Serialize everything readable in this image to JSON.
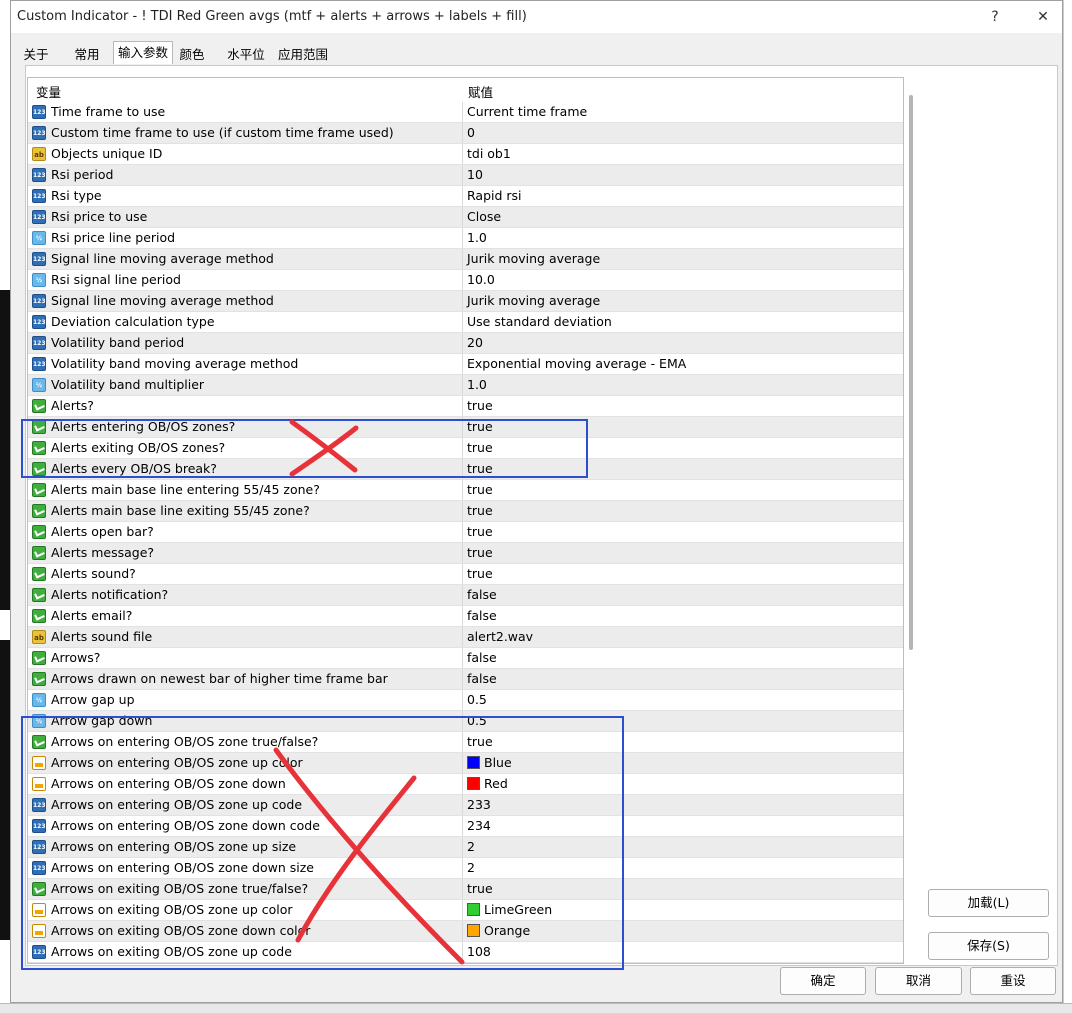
{
  "window": {
    "title": "Custom Indicator - ! TDI Red Green avgs  (mtf + alerts + arrows + labels + fill)",
    "help_glyph": "?",
    "close_glyph": "✕"
  },
  "tabs": [
    {
      "label": "关于"
    },
    {
      "label": "常用"
    },
    {
      "label": "输入参数"
    },
    {
      "label": "颜色"
    },
    {
      "label": "水平位"
    },
    {
      "label": "应用范围"
    }
  ],
  "table": {
    "col_variable": "变量",
    "col_value": "赋值",
    "rows": [
      {
        "type": "int",
        "name": "Time frame to use",
        "value": "Current time frame"
      },
      {
        "type": "int",
        "name": "Custom time frame to use (if custom time frame used)",
        "value": "0"
      },
      {
        "type": "str",
        "name": "Objects unique ID",
        "value": "tdi ob1"
      },
      {
        "type": "int",
        "name": "Rsi period",
        "value": "10"
      },
      {
        "type": "int",
        "name": "Rsi type",
        "value": "Rapid rsi"
      },
      {
        "type": "int",
        "name": "Rsi price to use",
        "value": "Close"
      },
      {
        "type": "dbl",
        "name": "Rsi price line period",
        "value": "1.0"
      },
      {
        "type": "int",
        "name": "Signal line moving average method",
        "value": "Jurik moving average"
      },
      {
        "type": "dbl",
        "name": "Rsi signal line period",
        "value": "10.0"
      },
      {
        "type": "int",
        "name": "Signal line moving average method",
        "value": "Jurik moving average"
      },
      {
        "type": "int",
        "name": "Deviation calculation type",
        "value": "Use standard deviation"
      },
      {
        "type": "int",
        "name": "Volatility band period",
        "value": "20"
      },
      {
        "type": "int",
        "name": "Volatility band moving average method",
        "value": "Exponential moving average - EMA"
      },
      {
        "type": "dbl",
        "name": "Volatility band multiplier",
        "value": "1.0"
      },
      {
        "type": "bool",
        "name": "Alerts?",
        "value": "true"
      },
      {
        "type": "bool",
        "name": "Alerts entering OB/OS zones?",
        "value": "true"
      },
      {
        "type": "bool",
        "name": "Alerts exiting OB/OS zones?",
        "value": "true"
      },
      {
        "type": "bool",
        "name": "Alerts every OB/OS break?",
        "value": "true"
      },
      {
        "type": "bool",
        "name": "Alerts main base line entering 55/45 zone?",
        "value": "true"
      },
      {
        "type": "bool",
        "name": "Alerts main base line exiting 55/45 zone?",
        "value": "true"
      },
      {
        "type": "bool",
        "name": "Alerts open bar?",
        "value": "true"
      },
      {
        "type": "bool",
        "name": "Alerts message?",
        "value": "true"
      },
      {
        "type": "bool",
        "name": "Alerts sound?",
        "value": "true"
      },
      {
        "type": "bool",
        "name": "Alerts notification?",
        "value": "false"
      },
      {
        "type": "bool",
        "name": "Alerts email?",
        "value": "false"
      },
      {
        "type": "str",
        "name": "Alerts sound file",
        "value": "alert2.wav"
      },
      {
        "type": "bool",
        "name": "Arrows?",
        "value": "false"
      },
      {
        "type": "bool",
        "name": "Arrows drawn on newest bar of higher time frame bar",
        "value": "false"
      },
      {
        "type": "dbl",
        "name": "Arrow gap up",
        "value": "0.5"
      },
      {
        "type": "dbl",
        "name": "Arrow gap down",
        "value": "0.5"
      },
      {
        "type": "bool",
        "name": "Arrows on entering OB/OS zone true/false?",
        "value": "true"
      },
      {
        "type": "clr",
        "name": "Arrows on entering OB/OS zone up color",
        "value": "Blue",
        "swatch": "#0000ff"
      },
      {
        "type": "clr",
        "name": "Arrows on entering OB/OS zone down",
        "value": "Red",
        "swatch": "#ff0000"
      },
      {
        "type": "int",
        "name": "Arrows on entering OB/OS zone up code",
        "value": "233"
      },
      {
        "type": "int",
        "name": "Arrows on entering OB/OS zone down code",
        "value": "234"
      },
      {
        "type": "int",
        "name": "Arrows on entering OB/OS zone up size",
        "value": "2"
      },
      {
        "type": "int",
        "name": "Arrows on entering OB/OS zone down size",
        "value": "2"
      },
      {
        "type": "bool",
        "name": "Arrows on exiting OB/OS zone true/false?",
        "value": "true"
      },
      {
        "type": "clr",
        "name": "Arrows on exiting OB/OS zone up color",
        "value": "LimeGreen",
        "swatch": "#32cd32"
      },
      {
        "type": "clr",
        "name": "Arrows on exiting OB/OS zone down color",
        "value": "Orange",
        "swatch": "#ffa500"
      },
      {
        "type": "int",
        "name": "Arrows on exiting OB/OS zone up code",
        "value": "108"
      }
    ]
  },
  "icon_labels": {
    "int": "123",
    "dbl": "½",
    "str": "ab"
  },
  "buttons": {
    "load": "加载(L)",
    "save": "保存(S)",
    "ok": "确定",
    "cancel": "取消",
    "reset": "重设"
  },
  "colors": {
    "annotation_box": "#2b4fcf",
    "annotation_x": "#e8323a"
  }
}
